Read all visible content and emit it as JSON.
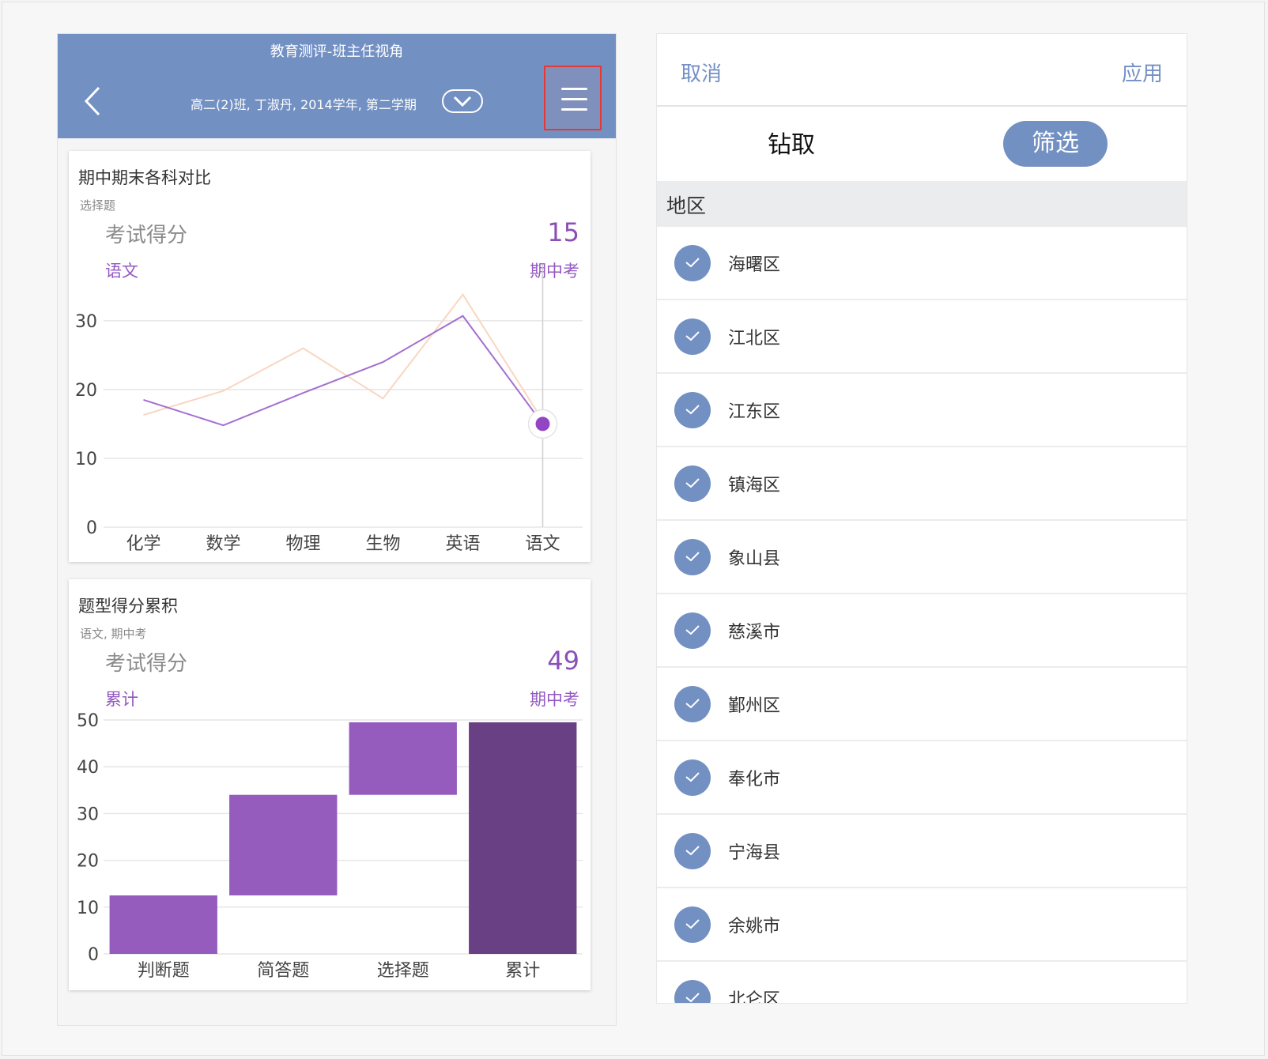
{
  "header": {
    "title": "教育测评-班主任视角",
    "subtitle": "高二(2)班, 丁淑丹, 2014学年, 第二学期"
  },
  "card1": {
    "title": "期中期末各科对比",
    "subtitle": "选择题",
    "metric_label": "考试得分",
    "metric_value": "15",
    "series_label": "语文",
    "period_label": "期中考"
  },
  "card2": {
    "title": "题型得分累积",
    "subtitle": "语文, 期中考",
    "metric_label": "考试得分",
    "metric_value": "49",
    "series_label": "累计",
    "period_label": "期中考"
  },
  "chart_data": [
    {
      "type": "line",
      "title": "期中期末各科对比",
      "subtitle": "选择题",
      "categories": [
        "化学",
        "数学",
        "物理",
        "生物",
        "英语",
        "语文"
      ],
      "series": [
        {
          "values": [
            18.5,
            14.8,
            19.5,
            24,
            30.7,
            15
          ],
          "color": "#a36fd0"
        },
        {
          "values": [
            16.3,
            19.8,
            26,
            18.7,
            33.8,
            15.5
          ],
          "color": "#f9d6c1"
        }
      ],
      "yticks": [
        0,
        10,
        20,
        30
      ],
      "ylim": [
        0,
        34
      ],
      "highlight_index": 5,
      "grid": true
    },
    {
      "type": "bar",
      "title": "题型得分累积",
      "subtitle": "语文, 期中考",
      "categories": [
        "判断题",
        "简答题",
        "选择题",
        "累计"
      ],
      "series": [
        {
          "start": [
            0,
            12.5,
            34,
            0
          ],
          "end": [
            12.5,
            34,
            49.5,
            49.5
          ]
        }
      ],
      "colors": [
        "#955cbe",
        "#955cbe",
        "#955cbe",
        "#6a4085"
      ],
      "yticks": [
        0,
        10,
        20,
        30,
        40,
        50
      ],
      "ylim": [
        0,
        50
      ],
      "grid": true
    }
  ],
  "panel": {
    "cancel": "取消",
    "apply": "应用",
    "tab_drill": "钻取",
    "tab_filter": "筛选",
    "section_title": "地区",
    "regions": [
      "海曙区",
      "江北区",
      "江东区",
      "镇海区",
      "象山县",
      "慈溪市",
      "鄞州区",
      "奉化市",
      "宁海县",
      "余姚市",
      "北仑区"
    ]
  }
}
